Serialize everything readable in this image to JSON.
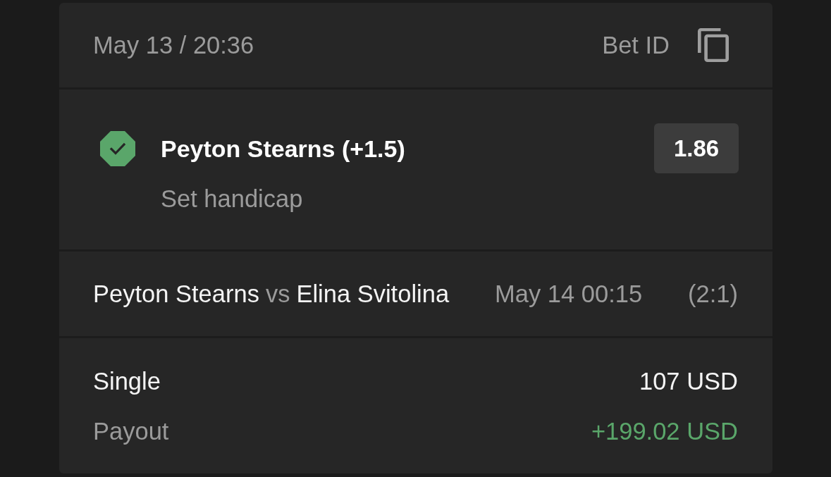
{
  "header": {
    "datetime": "May 13 / 20:36",
    "bet_id_label": "Bet ID"
  },
  "selection": {
    "name": "Peyton Stearns (+1.5)",
    "market": "Set handicap",
    "odds": "1.86",
    "won": true
  },
  "event": {
    "home": "Peyton Stearns",
    "separator": "vs",
    "away": "Elina Svitolina",
    "start": "May 14 00:15",
    "score": "(2:1)"
  },
  "summary": [
    {
      "kind": "stake",
      "label": "Single",
      "value": "107 USD"
    },
    {
      "kind": "payout",
      "label": "Payout",
      "value": "+199.02 USD"
    }
  ]
}
